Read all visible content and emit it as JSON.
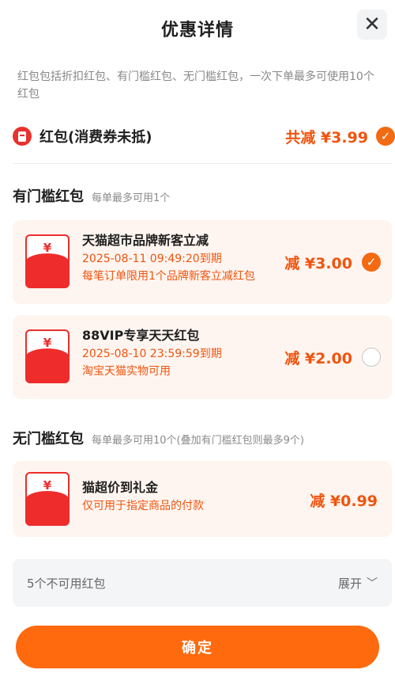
{
  "header": {
    "title": "优惠详情",
    "close_icon": "close-icon"
  },
  "description": "红包包括折扣红包、有门槛红包、无门槛红包，一次下单最多可使用10个红包",
  "summary": {
    "label": "红包(消费券未抵)",
    "total": "共减 ¥3.99",
    "checked": true
  },
  "threshold_section": {
    "title": "有门槛红包",
    "subtitle": "每单最多可用1个",
    "cards": [
      {
        "title": "天猫超市品牌新客立减",
        "line1": "2025-08-11 09:49:20到期",
        "line2": "每笔订单限用1个品牌新客立减红包",
        "amount": "减 ¥3.00",
        "checked": true
      },
      {
        "title": "88VIP专享天天红包",
        "line1": "2025-08-10 23:59:59到期",
        "line2": "淘宝天猫实物可用",
        "amount": "减 ¥2.00",
        "checked": false
      }
    ]
  },
  "no_threshold_section": {
    "title": "无门槛红包",
    "subtitle": "每单最多可用10个(叠加有门槛红包则最多9个)",
    "cards": [
      {
        "title": "猫超价到礼金",
        "line1": "仅可用于指定商品的付款",
        "amount": "减 ¥0.99"
      }
    ]
  },
  "unavailable": {
    "label": "5个不可用红包",
    "expand": "展开"
  },
  "confirm": "确定",
  "colors": {
    "accent": "#f0540e",
    "button": "#ff6a0e",
    "envelope": "#ee2c2c",
    "card_bg": "#fff5f0"
  },
  "icons": {
    "yen": "¥",
    "check": "✓",
    "chevron": "chevron-down-icon"
  }
}
